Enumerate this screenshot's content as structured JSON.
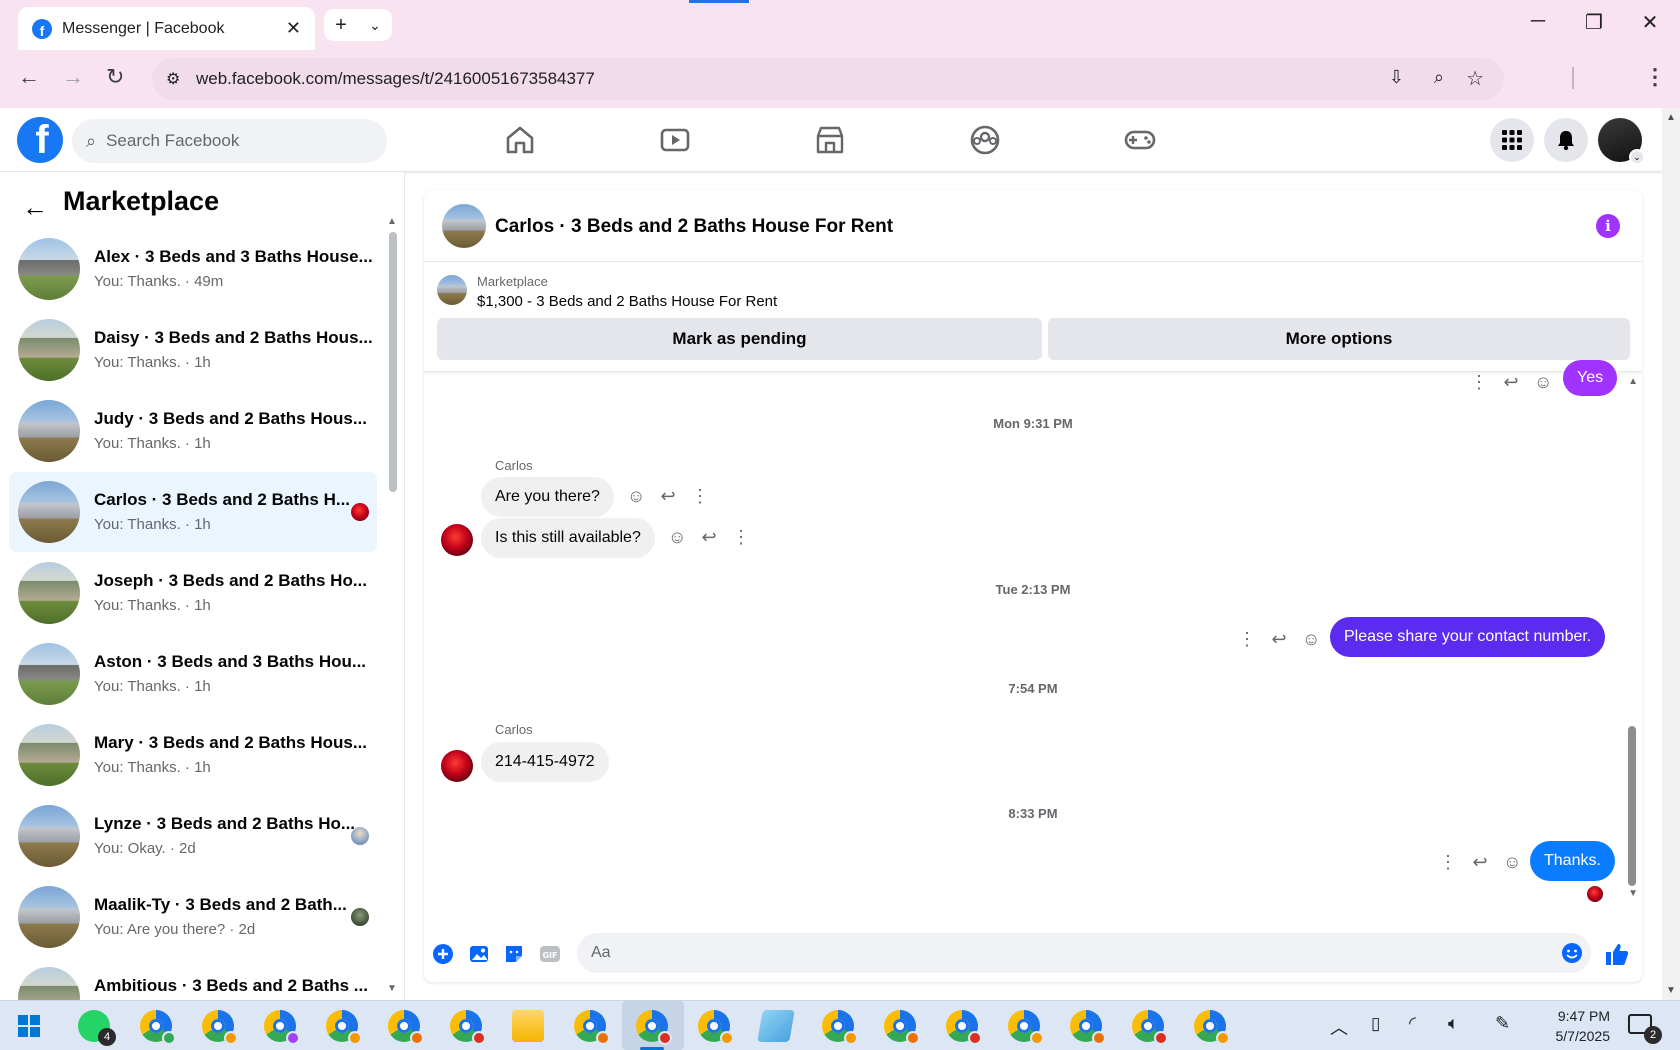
{
  "browser": {
    "tab_title": "Messenger | Facebook",
    "url": "web.facebook.com/messages/t/24160051673584377"
  },
  "facebook": {
    "search_placeholder": "Search Facebook"
  },
  "sidebar": {
    "title": "Marketplace",
    "conversations": [
      {
        "name": "Alex · 3 Beds and 3 Baths House...",
        "snippet": "You: Thanks. · 49m"
      },
      {
        "name": "Daisy · 3 Beds and 2 Baths Hous...",
        "snippet": "You: Thanks. · 1h"
      },
      {
        "name": "Judy · 3 Beds and 2 Baths Hous...",
        "snippet": "You: Thanks. · 1h"
      },
      {
        "name": "Carlos · 3 Beds and 2 Baths H...",
        "snippet": "You: Thanks. · 1h"
      },
      {
        "name": "Joseph · 3 Beds and 2 Baths Ho...",
        "snippet": "You: Thanks. · 1h"
      },
      {
        "name": "Aston · 3 Beds and 3 Baths Hou...",
        "snippet": "You: Thanks. · 1h"
      },
      {
        "name": "Mary · 3 Beds and 2 Baths Hous...",
        "snippet": "You: Thanks. · 1h"
      },
      {
        "name": "Lynze · 3 Beds and 2 Baths Ho...",
        "snippet": "You: Okay. · 2d"
      },
      {
        "name": "Maalik-Ty · 3 Beds and 2 Bath...",
        "snippet": "You: Are you there? · 2d"
      },
      {
        "name": "Ambitious · 3 Beds and 2 Baths ...",
        "snippet": ""
      }
    ]
  },
  "chat": {
    "title": "Carlos · 3 Beds and 2 Baths House For Rent",
    "listing_label": "Marketplace",
    "listing_price": "$1,300 - 3 Beds and 2 Baths House For Rent",
    "mark_pending": "Mark as pending",
    "more_options": "More options",
    "messages": {
      "yes": "Yes",
      "ts1": "Mon 9:31 PM",
      "sender1": "Carlos",
      "m1": "Are you there?",
      "m2": "Is this still available?",
      "ts2": "Tue 2:13 PM",
      "m3": "Please share your contact number.",
      "ts3": "7:54 PM",
      "sender2": "Carlos",
      "m4": "214-415-4972",
      "ts4": "8:33 PM",
      "m5": "Thanks."
    },
    "composer_placeholder": "Aa",
    "colors": {
      "purple": "#a033ff",
      "indigo": "#5b2bf0",
      "blue": "#0a7cff"
    }
  },
  "taskbar": {
    "whatsapp_badge": "4",
    "time": "9:47 PM",
    "date": "5/7/2025",
    "notif_count": "2"
  }
}
